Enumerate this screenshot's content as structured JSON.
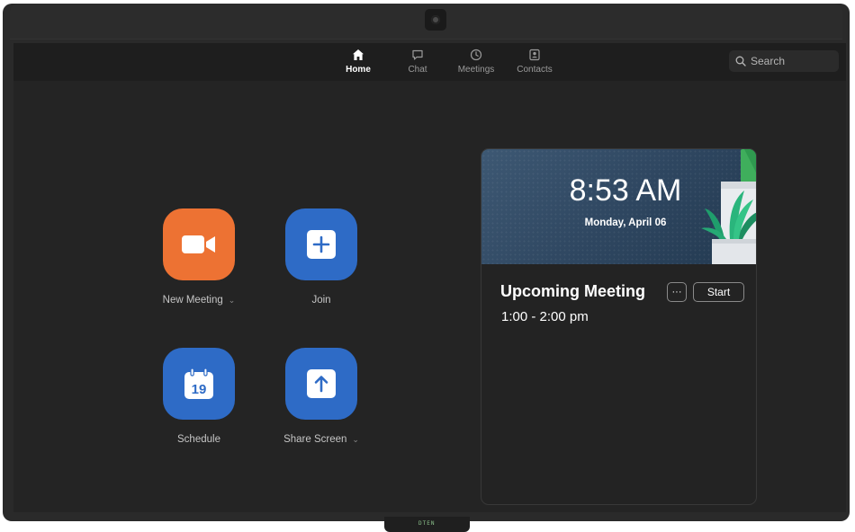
{
  "nav": {
    "items": [
      {
        "label": "Home",
        "icon": "home-icon",
        "active": true
      },
      {
        "label": "Chat",
        "icon": "chat-icon",
        "active": false
      },
      {
        "label": "Meetings",
        "icon": "clock-icon",
        "active": false
      },
      {
        "label": "Contacts",
        "icon": "contacts-icon",
        "active": false
      }
    ]
  },
  "search": {
    "placeholder": "Search",
    "icon": "search-icon"
  },
  "actions": {
    "new_meeting": {
      "label": "New Meeting",
      "icon": "video-camera-icon",
      "color": "#ed7233"
    },
    "join": {
      "label": "Join",
      "icon": "plus-icon",
      "color": "#2e6bc6"
    },
    "schedule": {
      "label": "Schedule",
      "icon": "calendar-icon",
      "day": "19",
      "color": "#2e6bc6"
    },
    "share_screen": {
      "label": "Share Screen",
      "icon": "upload-arrow-icon",
      "color": "#2e6bc6"
    }
  },
  "meeting_card": {
    "time": "8:53 AM",
    "date": "Monday, April 06",
    "title": "Upcoming Meeting",
    "more_label": "···",
    "start_label": "Start",
    "slot": "1:00 - 2:00 pm"
  },
  "device": {
    "stand_label": "DTEN"
  }
}
